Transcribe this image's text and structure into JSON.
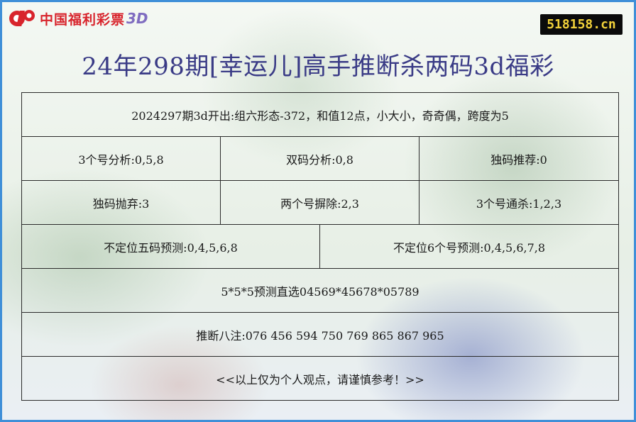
{
  "logo": {
    "text": "中国福利彩票",
    "suffix": "3D",
    "icon": "welfare-lottery-logo-icon",
    "colors": {
      "red": "#d8242c",
      "purple": "#7f6cc0"
    }
  },
  "badge": {
    "text": "518158.cn",
    "color": "#f2d23a",
    "background": "#0b0b0b"
  },
  "title": "24年298期[幸运儿]高手推断杀两码3d福彩",
  "rows": {
    "r1": "2024297期3d开出:组六形态-372，和值12点，小大小，奇奇偶，跨度为5",
    "r2": [
      "3个号分析:0,5,8",
      "双码分析:0,8",
      "独码推荐:0"
    ],
    "r3": [
      "独码抛弃:3",
      "两个号摒除:2,3",
      "3个号通杀:1,2,3"
    ],
    "r4": [
      "不定位五码预测:0,4,5,6,8",
      "不定位6个号预测:0,4,5,6,7,8"
    ],
    "r5": "5*5*5预测直选04569*45678*05789",
    "r6": "推断八注:076 456 594 750 769 865 867 965",
    "r7": "<<以上仅为个人观点，请谨慎参考！>>"
  },
  "colors": {
    "border": "#3f8fd8",
    "title": "#3a3b86"
  }
}
